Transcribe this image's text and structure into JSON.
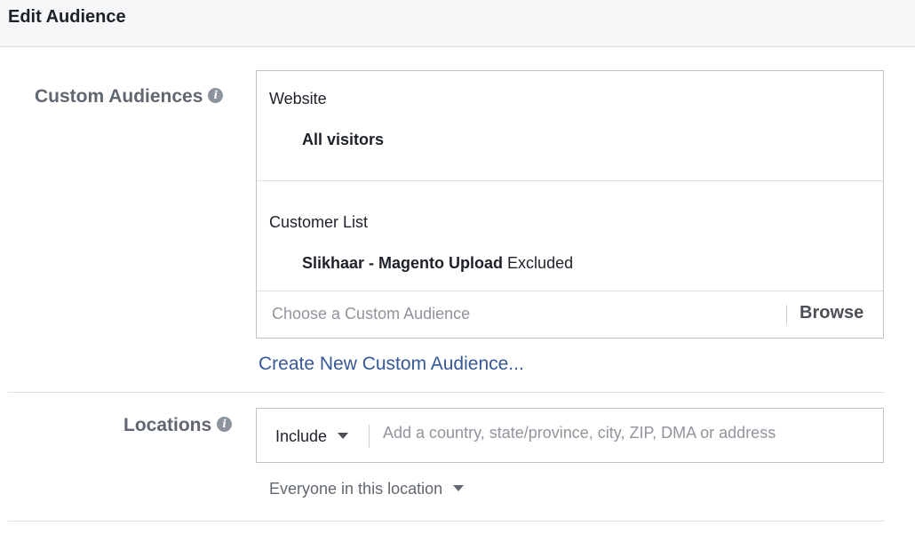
{
  "header": {
    "title": "Edit Audience"
  },
  "custom_audiences": {
    "label": "Custom Audiences",
    "info_icon": "i",
    "items": [
      {
        "type": "Website",
        "name": "All visitors",
        "status": ""
      },
      {
        "type": "Customer List",
        "name": "Slikhaar - Magento Upload",
        "status": "Excluded"
      }
    ],
    "search_placeholder": "Choose a Custom Audience",
    "browse_label": "Browse",
    "create_link": "Create New Custom Audience..."
  },
  "locations": {
    "label": "Locations",
    "info_icon": "i",
    "include_value": "Include",
    "search_placeholder": "Add a country, state/province, city, ZIP, DMA or address",
    "scope_value": "Everyone in this location"
  },
  "colors": {
    "link": "#365899",
    "label": "#606770",
    "border": "#bec3c9"
  }
}
